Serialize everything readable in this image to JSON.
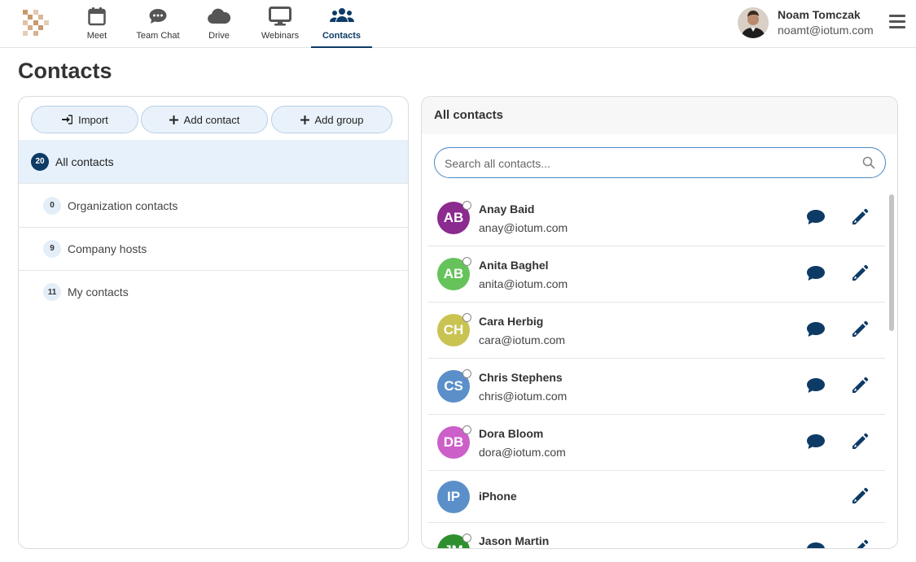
{
  "nav": {
    "items": [
      {
        "label": "Meet",
        "icon": "calendar-icon"
      },
      {
        "label": "Team Chat",
        "icon": "chat-bubble-icon"
      },
      {
        "label": "Drive",
        "icon": "cloud-icon"
      },
      {
        "label": "Webinars",
        "icon": "monitor-icon"
      },
      {
        "label": "Contacts",
        "icon": "users-icon",
        "active": true
      }
    ]
  },
  "user": {
    "name": "Noam Tomczak",
    "email": "noamt@iotum.com"
  },
  "page": {
    "title": "Contacts"
  },
  "left": {
    "buttons": {
      "import": "Import",
      "add_contact": "Add contact",
      "add_group": "Add group"
    },
    "groups": [
      {
        "count": "20",
        "label": "All contacts",
        "selected": true
      },
      {
        "count": "0",
        "label": "Organization contacts"
      },
      {
        "count": "9",
        "label": "Company hosts"
      },
      {
        "count": "11",
        "label": "My contacts"
      }
    ]
  },
  "right": {
    "title": "All contacts",
    "search_placeholder": "Search all contacts...",
    "contacts": [
      {
        "initials": "AB",
        "name": "Anay Baid",
        "email": "anay@iotum.com",
        "color": "#8b2a8f"
      },
      {
        "initials": "AB",
        "name": "Anita Baghel",
        "email": "anita@iotum.com",
        "color": "#66c35c"
      },
      {
        "initials": "CH",
        "name": "Cara Herbig",
        "email": "cara@iotum.com",
        "color": "#c9c452"
      },
      {
        "initials": "CS",
        "name": "Chris Stephens",
        "email": "chris@iotum.com",
        "color": "#5b8fc9"
      },
      {
        "initials": "DB",
        "name": "Dora Bloom",
        "email": "dora@iotum.com",
        "color": "#cc5fc8"
      },
      {
        "initials": "IP",
        "name": "iPhone",
        "email": "",
        "color": "#5b8fc9"
      },
      {
        "initials": "JM",
        "name": "Jason Martin",
        "email": "",
        "color": "#2e8f2e"
      }
    ]
  },
  "colors": {
    "brand_dark": "#0d3b66",
    "accent_light": "#e6f1fc"
  }
}
